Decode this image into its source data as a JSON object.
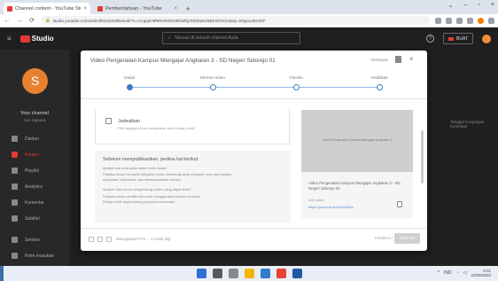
{
  "browser": {
    "tabs": [
      {
        "title": "Channel content - YouTube Studio",
        "active": true
      },
      {
        "title": "Pemberitahuan - YouTube",
        "active": false
      }
    ],
    "new_tab": "+",
    "url": "studio.youtube.com/video/lbt2n51Ml5w/edit?c=UCgq4H9f9NnRWZN8kkdfQ4NfZ5aNz8BZXKhXGI&ap=lz8gcwJ6V2ZF",
    "icons": [
      "back-icon",
      "forward-icon",
      "reload-icon",
      "star-icon",
      "extension-icon",
      "profile-icon",
      "menu-icon"
    ]
  },
  "studio": {
    "logo": "Studio",
    "search_placeholder": "Telusuri di seluruh channel Anda",
    "create_label": "BUAT",
    "channel_name": "Your channel",
    "channel_sub": "Aris Saputra",
    "sidebar": [
      {
        "label": "Dasbor",
        "icon": "dashboard-icon",
        "active": false
      },
      {
        "label": "Konten",
        "icon": "content-icon",
        "active": true
      },
      {
        "label": "Playlist",
        "icon": "playlist-icon",
        "active": false
      },
      {
        "label": "Analytics",
        "icon": "analytics-icon",
        "active": false
      },
      {
        "label": "Komentar",
        "icon": "comments-icon",
        "active": false
      },
      {
        "label": "Subtitel",
        "icon": "subtitles-icon",
        "active": false
      },
      {
        "label": "Setelan",
        "icon": "settings-icon",
        "active": false
      },
      {
        "label": "Kirim masukan",
        "icon": "feedback-icon",
        "active": false
      }
    ],
    "right_text": "Tanggal  Kunjungan  Komentar"
  },
  "dialog": {
    "title": "Video Pengenalan Kampus Mengajar Angkatan 3 - SD Negeri Sidorejo 01",
    "status": "Disimpan",
    "steps": [
      "Detail",
      "Elemen video",
      "Checks",
      "Visibilitas"
    ],
    "schedule": {
      "title": "Jadwalkan",
      "subtitle": "Pilih tanggal untuk menjadikan video Anda publik"
    },
    "publish_box": {
      "title": "Sebelum mempublikasikan, periksa hal berikut:",
      "lines": [
        "Apakah ada anak-anak dalam video Anda?",
        "Pastikan Anda mematuhi kebijakan untuk melindungi anak di bawah umur dari bahaya,",
        "eksploitasi, pelecehan, dan membahayakan mereka.",
        "Apakah video Anda mengandung konten yang dapat dicari?",
        "Pastikan Anda memiliki hak untuk menggunakan konten tersebut.",
        "Pelajari lebih lanjut tentang pedoman komunitas."
      ]
    },
    "preview": {
      "thumb_text": "Video Pengenalan Kampus Mengajar Angkatan 3",
      "title": "Video Pengenalan Kampus Mengajar Angkatan 3 - SD Negeri Sidorejo 01",
      "link_label": "Link video",
      "link": "https://youtu.be/lbt2n51Ml5w"
    },
    "footer": {
      "status_text": "Mengupload 97% ... 1 menit lagi",
      "back_label": "KEMBALI",
      "save_label": "SIMPAN"
    }
  },
  "taskbar": {
    "time": "9:31",
    "date": "22/06/2022",
    "lang": "IND"
  }
}
